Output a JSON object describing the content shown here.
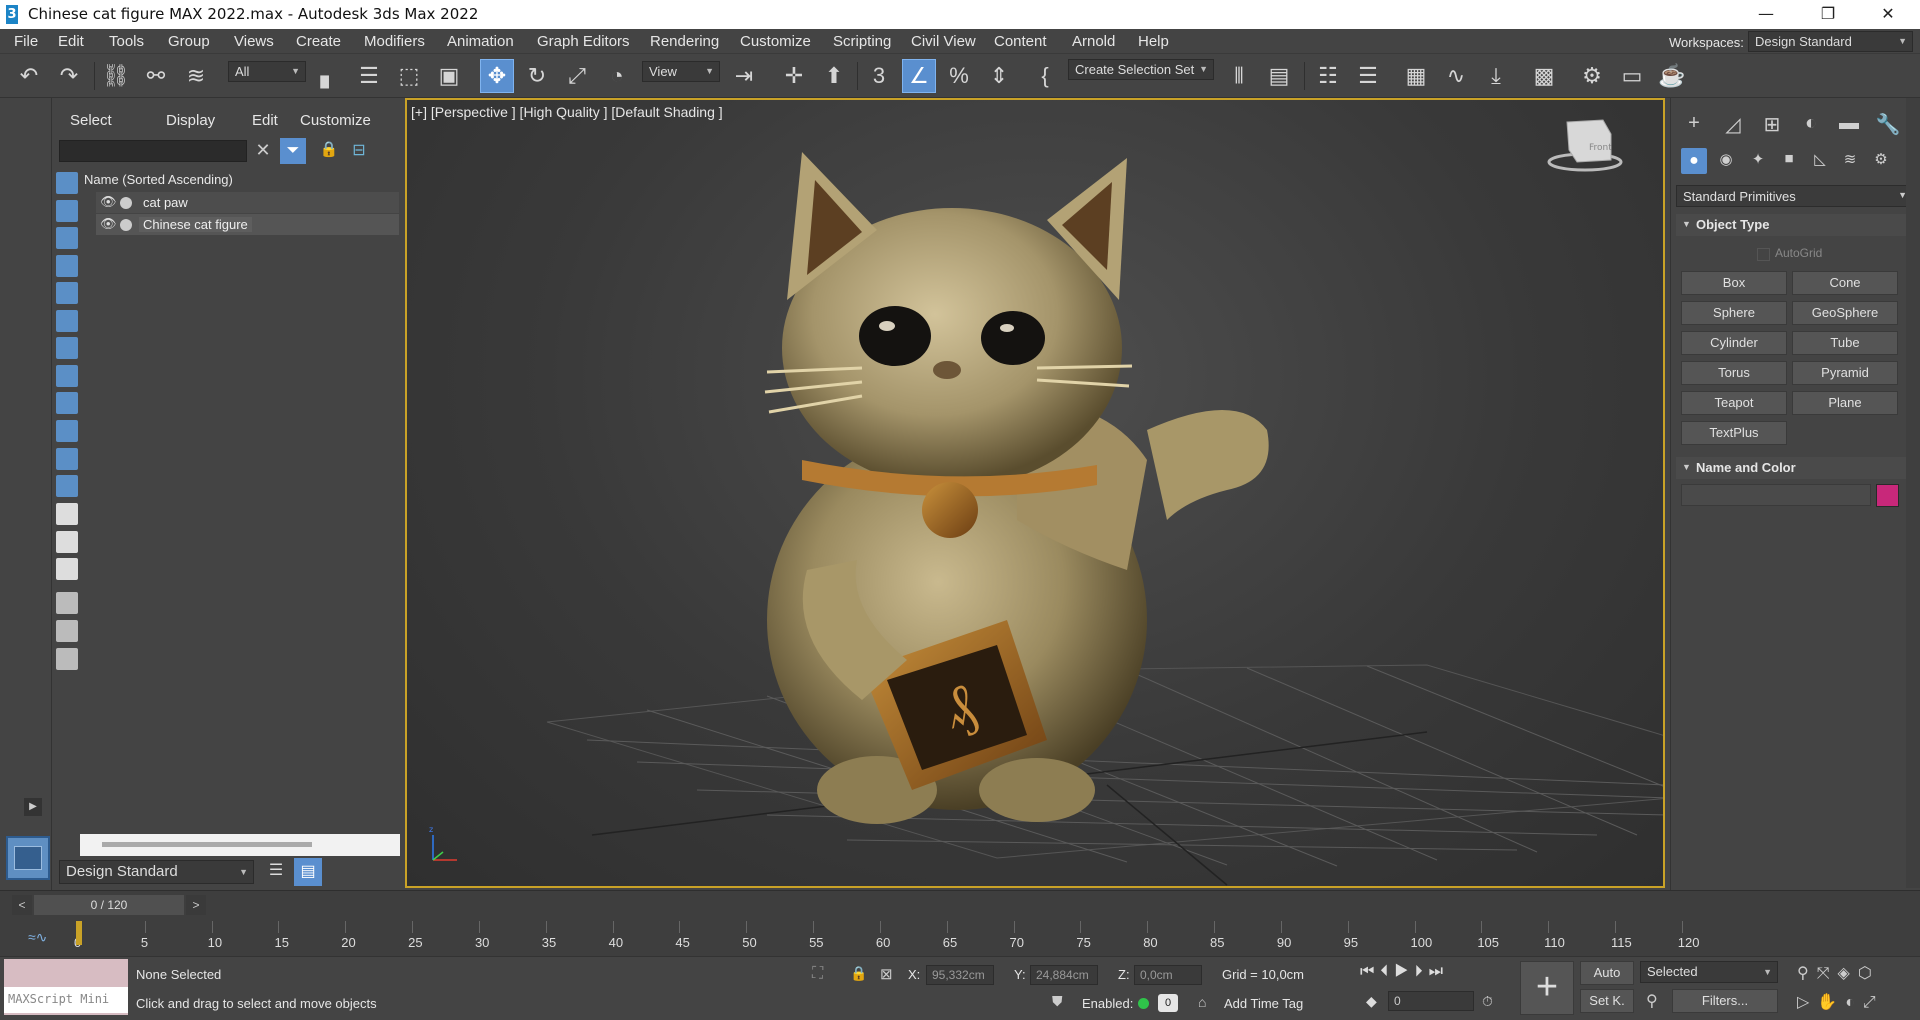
{
  "window": {
    "title": "Chinese cat figure MAX 2022.max - Autodesk 3ds Max 2022"
  },
  "menubar": {
    "items": [
      "File",
      "Edit",
      "Tools",
      "Group",
      "Views",
      "Create",
      "Modifiers",
      "Animation",
      "Graph Editors",
      "Rendering",
      "Customize",
      "Scripting",
      "Civil View",
      "Content",
      "Arnold",
      "Help"
    ],
    "workspaces_label": "Workspaces:",
    "workspace_value": "Design Standard"
  },
  "toolbar": {
    "filter_value": "All",
    "ref_coord_value": "View",
    "selection_set_value": "Create Selection Set"
  },
  "explorer": {
    "menu": [
      "Select",
      "Display",
      "Edit",
      "Customize"
    ],
    "search_placeholder": "",
    "column_header": "Name (Sorted Ascending)",
    "rows": [
      {
        "name": "cat paw",
        "selected": false
      },
      {
        "name": "Chinese cat figure",
        "selected": true
      }
    ],
    "workspace_value": "Design Standard"
  },
  "viewport": {
    "label": "[+] [Perspective ] [High Quality ] [Default Shading ]",
    "viewcube_label": "Front"
  },
  "command_panel": {
    "category_value": "Standard Primitives",
    "object_type_title": "Object Type",
    "autogrid_label": "AutoGrid",
    "primitives": [
      "Box",
      "Cone",
      "Sphere",
      "GeoSphere",
      "Cylinder",
      "Tube",
      "Torus",
      "Pyramid",
      "Teapot",
      "Plane",
      "TextPlus"
    ],
    "name_color_title": "Name and Color",
    "object_color": "#c8287a"
  },
  "timeline": {
    "frame_indicator": "0 / 120",
    "prev_label": "<",
    "next_label": ">",
    "ticks": [
      "0",
      "5",
      "10",
      "15",
      "20",
      "25",
      "30",
      "35",
      "40",
      "45",
      "50",
      "55",
      "60",
      "65",
      "70",
      "75",
      "80",
      "85",
      "90",
      "95",
      "100",
      "105",
      "110",
      "115",
      "120"
    ]
  },
  "status": {
    "maxscript_placeholder": "MAXScript Mini",
    "selection_status": "None Selected",
    "prompt": "Click and drag to select and move objects",
    "x_label": "X:",
    "x_value": "95,332cm",
    "y_label": "Y:",
    "y_value": "24,884cm",
    "z_label": "Z:",
    "z_value": "0,0cm",
    "grid": "Grid = 10,0cm",
    "enabled_label": "Enabled:",
    "enabled_value": "0",
    "add_time_tag": "Add Time Tag",
    "auto_label": "Auto",
    "setk_label": "Set K.",
    "key_mode_value": "Selected",
    "filters_label": "Filters...",
    "frame_value": "0"
  }
}
